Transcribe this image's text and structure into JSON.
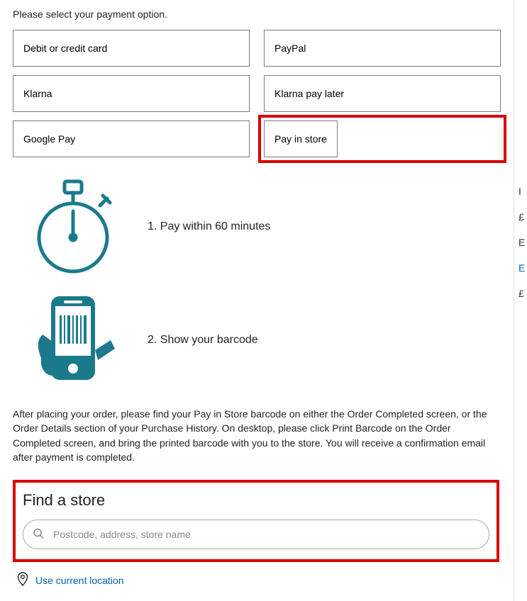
{
  "heading": "Please select your payment option.",
  "payment_options": [
    {
      "label": "Debit or credit card"
    },
    {
      "label": "PayPal"
    },
    {
      "label": "Klarna"
    },
    {
      "label": "Klarna pay later"
    },
    {
      "label": "Google Pay"
    },
    {
      "label": "Pay in store",
      "highlighted": true
    }
  ],
  "steps": {
    "step1": "1. Pay within 60 minutes",
    "step2": "2. Show your barcode"
  },
  "instructions": "After placing your order, please find your Pay in Store barcode on either the Order Completed screen, or the Order Details section of your Purchase History. On desktop, please click Print Barcode on the Order Completed screen, and bring the printed barcode with you to the store. You will receive a confirmation email after payment is completed.",
  "find_store": {
    "heading": "Find a store",
    "placeholder": "Postcode, address, store name",
    "use_location": "Use current location"
  },
  "right_strip": {
    "a": "I",
    "b": "£",
    "c": "E",
    "d": "E",
    "e": "£"
  },
  "colors": {
    "accent_teal": "#1a7a8c",
    "highlight_red": "#d90000",
    "link_blue": "#0064b1"
  }
}
